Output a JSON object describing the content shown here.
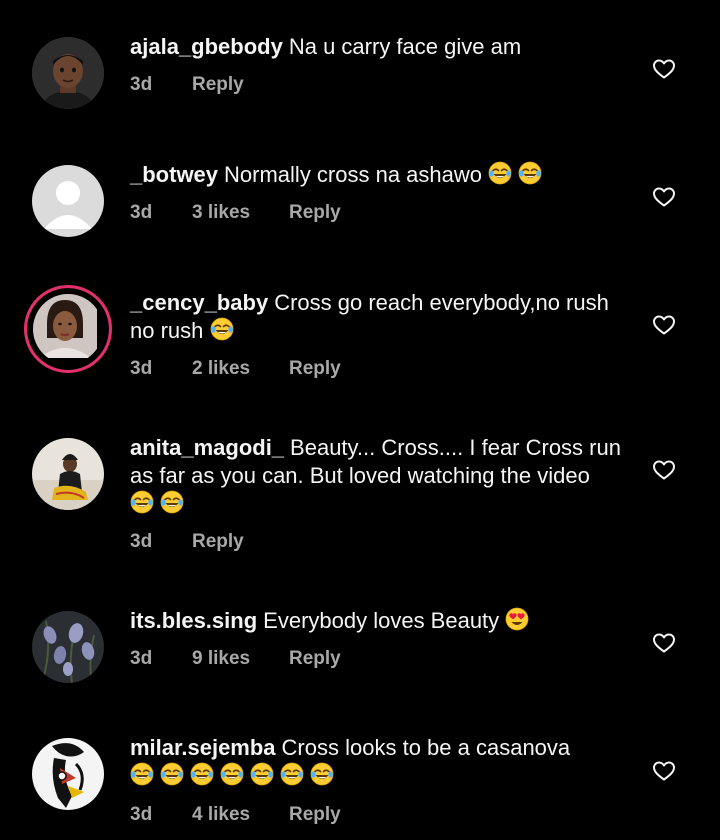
{
  "comments": [
    {
      "username": "ajala_gbebody",
      "text": "Na u carry face give am",
      "emoji": [],
      "time": "3d",
      "likes": "",
      "reply": "Reply",
      "avatar": "cartoon-avatar"
    },
    {
      "username": "_botwey",
      "text": "Normally cross na ashawo",
      "emoji": [
        "face-with-tears-of-joy",
        "face-with-tears-of-joy"
      ],
      "time": "3d",
      "likes": "3 likes",
      "reply": "Reply",
      "avatar": "default-avatar"
    },
    {
      "username": "_cency_baby",
      "text": "Cross go reach everybody,no rush no rush",
      "emoji": [
        "face-with-tears-of-joy"
      ],
      "time": "3d",
      "likes": "2 likes",
      "reply": "Reply",
      "avatar": "photo-avatar-story"
    },
    {
      "username": "anita_magodi_",
      "text": "Beauty... Cross.... I fear Cross run as far as you can. But loved watching the video",
      "emoji": [
        "face-with-tears-of-joy",
        "face-with-tears-of-joy"
      ],
      "time": "3d",
      "likes": "",
      "reply": "Reply",
      "avatar": "photo-avatar"
    },
    {
      "username": "its.bles.sing",
      "text": "Everybody loves Beauty",
      "emoji": [
        "smiling-face-with-heart-eyes"
      ],
      "time": "3d",
      "likes": "9 likes",
      "reply": "Reply",
      "avatar": "flower-avatar"
    },
    {
      "username": "milar.sejemba",
      "text": "Cross looks to be a casanova",
      "emoji": [
        "face-with-tears-of-joy",
        "face-with-tears-of-joy",
        "face-with-tears-of-joy",
        "face-with-tears-of-joy",
        "face-with-tears-of-joy",
        "face-with-tears-of-joy",
        "face-with-tears-of-joy"
      ],
      "time": "3d",
      "likes": "4 likes",
      "reply": "Reply",
      "avatar": "illustration-avatar"
    }
  ],
  "colors": {
    "background": "#000000",
    "text": "#f5f5f5",
    "meta": "#a8a8a8"
  }
}
